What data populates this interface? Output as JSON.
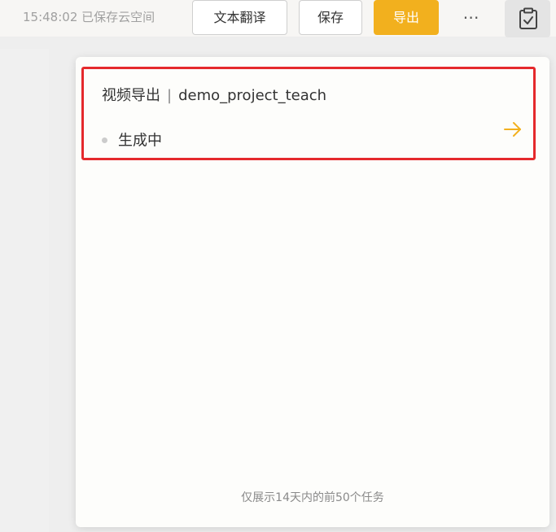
{
  "toolbar": {
    "save_status": "15:48:02 已保存云空间",
    "translate_label": "文本翻译",
    "save_label": "保存",
    "export_label": "导出",
    "more_icon": "more-horizontal-icon",
    "task_icon": "clipboard-check-icon"
  },
  "panel": {
    "task": {
      "type": "视频导出",
      "separator": "|",
      "name": "demo_project_teach",
      "status": "生成中",
      "arrow_icon": "arrow-right-icon"
    },
    "footer_note": "仅展示14天内的前50个任务"
  },
  "colors": {
    "accent": "#f2b01e",
    "highlight_border": "#e5292c",
    "status_dot": "#cccccc"
  }
}
